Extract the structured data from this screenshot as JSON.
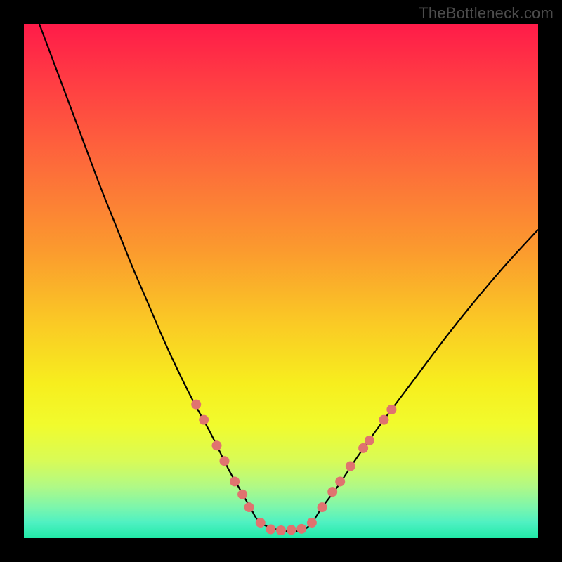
{
  "watermark": {
    "text": "TheBottleneck.com"
  },
  "chart_data": {
    "type": "line",
    "title": "",
    "xlabel": "",
    "ylabel": "",
    "xlim": [
      0,
      100
    ],
    "ylim": [
      0,
      100
    ],
    "gradient_stops": [
      {
        "offset": 0,
        "color": "#ff1b49"
      },
      {
        "offset": 0.12,
        "color": "#ff3f43"
      },
      {
        "offset": 0.28,
        "color": "#fd6d3a"
      },
      {
        "offset": 0.44,
        "color": "#fb9a2e"
      },
      {
        "offset": 0.58,
        "color": "#fac925"
      },
      {
        "offset": 0.7,
        "color": "#f7ee1e"
      },
      {
        "offset": 0.78,
        "color": "#f1fb2d"
      },
      {
        "offset": 0.85,
        "color": "#d8fb57"
      },
      {
        "offset": 0.9,
        "color": "#b0f986"
      },
      {
        "offset": 0.94,
        "color": "#7cf6ac"
      },
      {
        "offset": 0.97,
        "color": "#4ef1c2"
      },
      {
        "offset": 1.0,
        "color": "#21e9a7"
      }
    ],
    "series": [
      {
        "name": "bottleneck-curve",
        "color": "#000000",
        "x": [
          3,
          6,
          9,
          12,
          15,
          18,
          21,
          24,
          27,
          30,
          33,
          36,
          38,
          40,
          42,
          44,
          46,
          50,
          54,
          56,
          58,
          61,
          65,
          70,
          76,
          82,
          88,
          94,
          100
        ],
        "y": [
          100,
          92,
          84,
          76,
          68,
          60.5,
          53,
          46,
          39,
          32.5,
          26.5,
          21,
          17,
          13,
          9.5,
          6,
          3,
          1.5,
          1.5,
          3,
          6,
          10,
          16,
          23,
          31,
          39,
          46.5,
          53.5,
          60
        ]
      }
    ],
    "markers": {
      "name": "sample-dots",
      "color": "#e0736f",
      "radius_px": 7,
      "points": [
        {
          "x": 33.5,
          "y": 26
        },
        {
          "x": 35.0,
          "y": 23
        },
        {
          "x": 37.5,
          "y": 18
        },
        {
          "x": 39.0,
          "y": 15
        },
        {
          "x": 41.0,
          "y": 11
        },
        {
          "x": 42.5,
          "y": 8.5
        },
        {
          "x": 43.8,
          "y": 6
        },
        {
          "x": 46.0,
          "y": 3
        },
        {
          "x": 48.0,
          "y": 1.7
        },
        {
          "x": 50.0,
          "y": 1.5
        },
        {
          "x": 52.0,
          "y": 1.6
        },
        {
          "x": 54.0,
          "y": 1.8
        },
        {
          "x": 56.0,
          "y": 3
        },
        {
          "x": 58.0,
          "y": 6
        },
        {
          "x": 60.0,
          "y": 9
        },
        {
          "x": 61.5,
          "y": 11
        },
        {
          "x": 63.5,
          "y": 14
        },
        {
          "x": 66.0,
          "y": 17.5
        },
        {
          "x": 67.2,
          "y": 19
        },
        {
          "x": 70.0,
          "y": 23
        },
        {
          "x": 71.5,
          "y": 25
        }
      ]
    }
  }
}
